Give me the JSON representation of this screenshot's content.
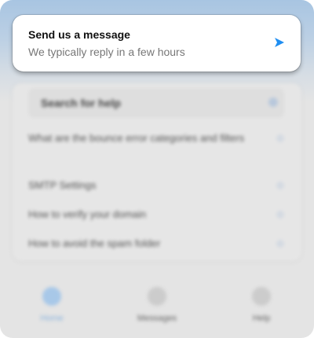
{
  "message_card": {
    "title": "Send us a message",
    "subtitle": "We typically reply in a few hours",
    "icon": "send-icon",
    "accent": "#1f8ef1"
  },
  "help": {
    "search_placeholder": "Search for help",
    "articles": [
      "What are the bounce error categories and filters",
      "SMTP Settings",
      "How to verify your domain",
      "How to avoid the spam folder"
    ]
  },
  "nav": {
    "tabs": [
      {
        "label": "Home",
        "active": true
      },
      {
        "label": "Messages",
        "active": false
      },
      {
        "label": "Help",
        "active": false
      }
    ]
  }
}
